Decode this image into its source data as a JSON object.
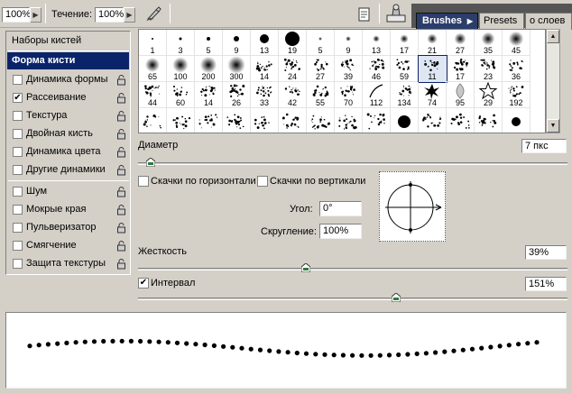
{
  "topbar": {
    "opacity_value": "100%",
    "flow_label": "Течение:",
    "flow_value": "100%",
    "dropdown_arrow": "▶",
    "tabs": [
      "Brushes",
      "Presets",
      "о слоев"
    ],
    "active_tab_arrow": "▶"
  },
  "left_panel": {
    "header": "Наборы кистей",
    "selected": "Форма кисти",
    "items": [
      {
        "label": "Динамика формы",
        "checked": false
      },
      {
        "label": "Рассеивание",
        "checked": true
      },
      {
        "label": "Текстура",
        "checked": false
      },
      {
        "label": "Двойная кисть",
        "checked": false
      },
      {
        "label": "Динамика цвета",
        "checked": false
      },
      {
        "label": "Другие динамики",
        "checked": false
      },
      {
        "label": "Шум",
        "checked": false
      },
      {
        "label": "Мокрые края",
        "checked": false
      },
      {
        "label": "Пульверизатор",
        "checked": false
      },
      {
        "label": "Смягчение",
        "checked": false
      },
      {
        "label": "Защита текстуры",
        "checked": false
      }
    ],
    "checkmark": "✔"
  },
  "brush_grid": {
    "rows": [
      [
        "1",
        "3",
        "5",
        "9",
        "13",
        "19",
        "5",
        "9",
        "13",
        "17",
        "21",
        "27",
        "35",
        "45"
      ],
      [
        "65",
        "100",
        "200",
        "300",
        "14",
        "24",
        "27",
        "39",
        "46",
        "59",
        "11",
        "17",
        "23",
        "36"
      ],
      [
        "44",
        "60",
        "14",
        "26",
        "33",
        "42",
        "55",
        "70",
        "112",
        "134",
        "74",
        "95",
        "29",
        "192"
      ],
      [
        "",
        "",
        "",
        "",
        "",
        "",
        "",
        "",
        "",
        "",
        "",
        "",
        "",
        ""
      ]
    ],
    "selected_row": 1,
    "selected_col": 10
  },
  "controls": {
    "diameter_label": "Диаметр",
    "diameter_value": "7 пкс",
    "diameter_level": 0.03,
    "flip_x_label": "Скачки по горизонтали",
    "flip_y_label": "Скачки по вертикали",
    "flip_x_checked": false,
    "flip_y_checked": false,
    "angle_label": "Угол:",
    "angle_value": "0°",
    "roundness_label": "Скругление:",
    "roundness_value": "100%",
    "hardness_label": "Жесткость",
    "hardness_value": "39%",
    "hardness_level": 0.39,
    "spacing_label": "Интервал",
    "spacing_checked": true,
    "spacing_value": "151%",
    "spacing_level": 0.6,
    "checkmark": "✔"
  }
}
